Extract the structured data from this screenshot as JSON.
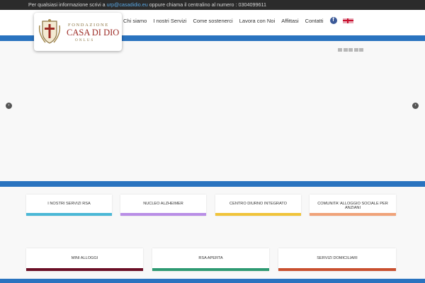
{
  "topbar": {
    "prefix": "Per qualsiasi informazione scrivi a ",
    "email": "urp@casadidio.eu",
    "suffix": " oppure chiama il centralino al numero : 0304099611"
  },
  "logo": {
    "line1": "FONDAZIONE",
    "line2": "CASA DI DIO",
    "line3": "ONLUS"
  },
  "nav": {
    "items": [
      "Chi siamo",
      "I nostri Servizi",
      "Come sostenerci",
      "Lavora con Noi",
      "Affittasi",
      "Contatti"
    ],
    "facebook_icon": "f"
  },
  "slider": {
    "prev_glyph": "‹",
    "next_glyph": "›",
    "slide_count": 5
  },
  "cards_row1": [
    {
      "label": "I NOSTRI SERVIZI RSA",
      "color": "#4bb8d6"
    },
    {
      "label": "NUCLEO ALZHEIMER",
      "color": "#b98ee6"
    },
    {
      "label": "CENTRO DIURNO INTEGRATO",
      "color": "#f0c43a"
    },
    {
      "label": "COMUNITA' ALLOGGIO SOCIALE PER ANZIANI",
      "color": "#f0a37a"
    }
  ],
  "cards_row2": [
    {
      "label": "MINI ALLOGGI",
      "color": "#6b0f26"
    },
    {
      "label": "RSA APERTA",
      "color": "#2e9a72"
    },
    {
      "label": "SERVIZI DOMICILIARI",
      "color": "#c9502f"
    }
  ]
}
